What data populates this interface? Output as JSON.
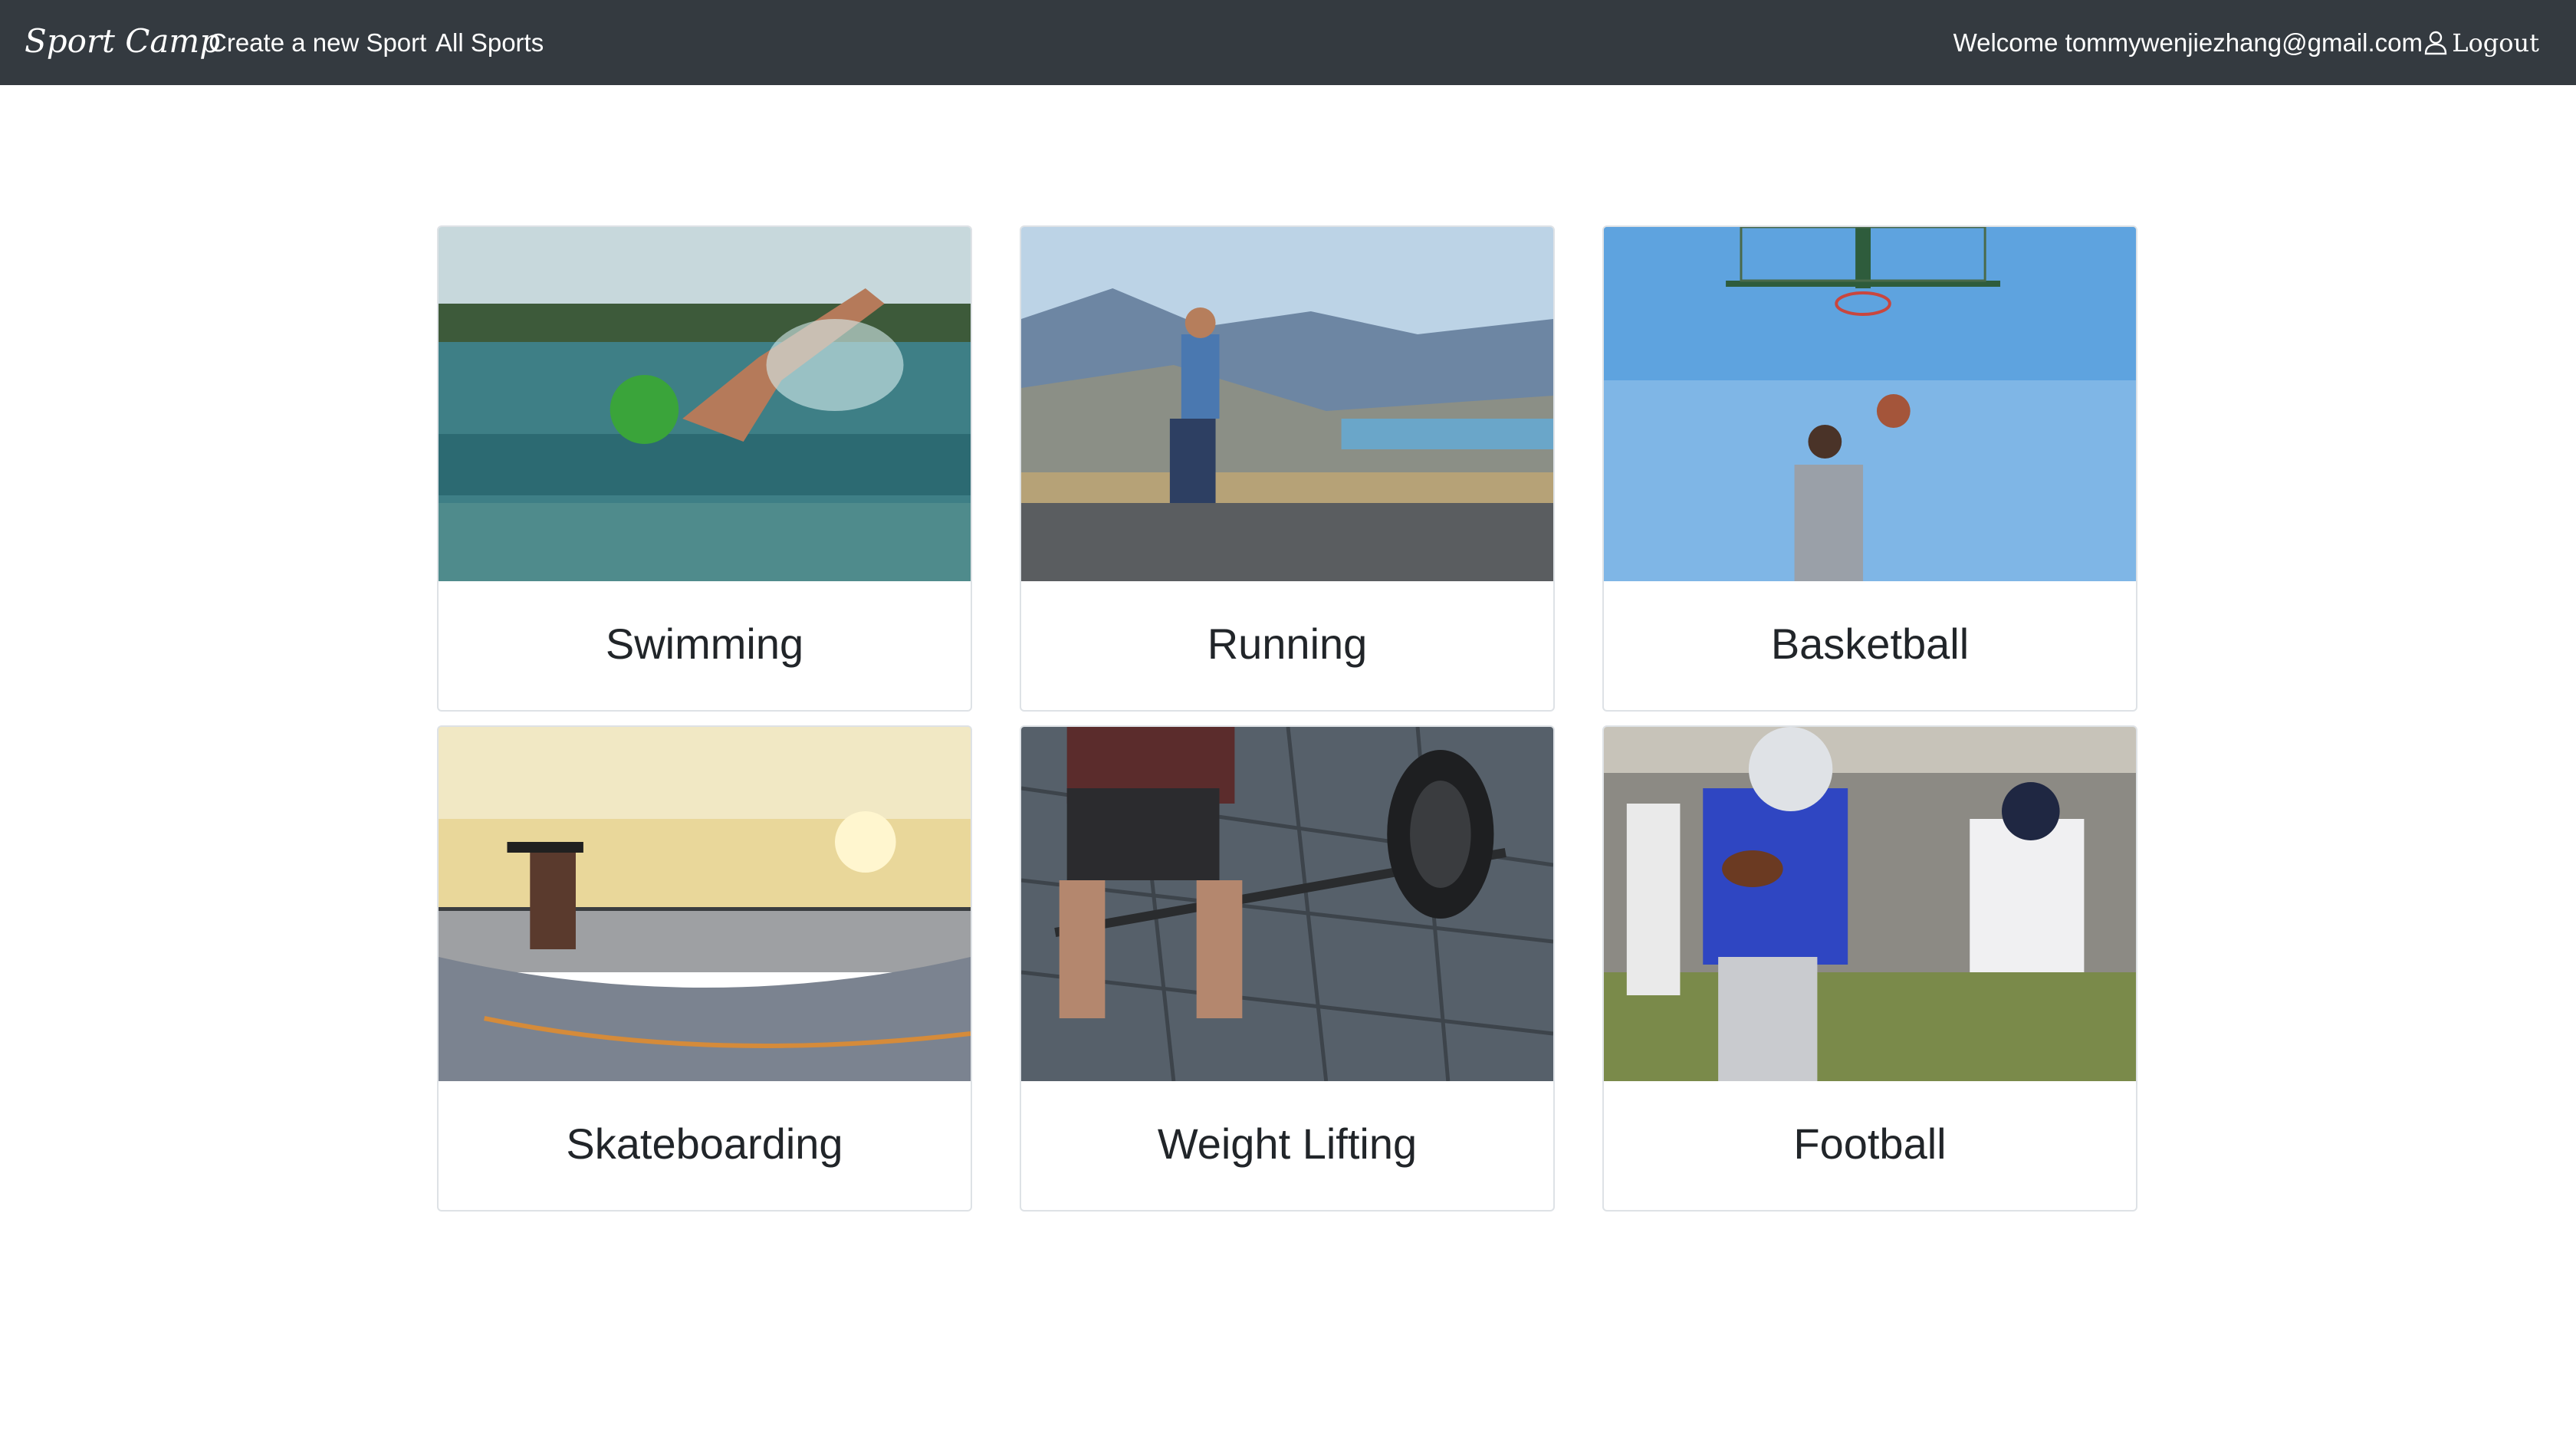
{
  "navbar": {
    "brand": "Sport Camp",
    "links": [
      {
        "label": "Create a new Sport"
      },
      {
        "label": "All Sports"
      }
    ],
    "welcome": "Welcome tommywenjiezhang@gmail.com",
    "logout": "Logout",
    "logout_icon": "person-icon",
    "background": "#343a40"
  },
  "sports": [
    {
      "title": "Swimming"
    },
    {
      "title": "Running"
    },
    {
      "title": "Basketball"
    },
    {
      "title": "Skateboarding"
    },
    {
      "title": "Weight Lifting"
    },
    {
      "title": "Football"
    }
  ]
}
